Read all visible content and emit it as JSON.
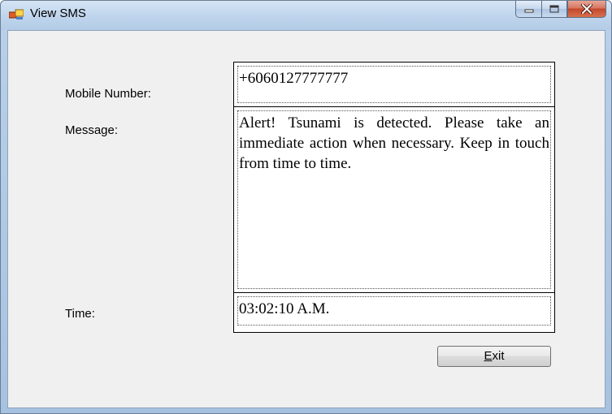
{
  "window": {
    "title": "View SMS",
    "controls": {
      "minimize": "minimize-icon",
      "maximize": "maximize-icon",
      "close": "close-icon"
    }
  },
  "form": {
    "mobile_label": "Mobile Number:",
    "message_label": "Message:",
    "time_label": "Time:",
    "mobile_value": "+6060127777777",
    "message_value": "Alert! Tsunami is detected. Please take an immediate action when necessary. Keep in touch from time to time.",
    "time_value": "03:02:10 A.M."
  },
  "exit_button": {
    "mnemonic": "E",
    "rest": "xit"
  },
  "colors": {
    "titlebar": "#c2d7ee",
    "close_button": "#c4472a",
    "client_background": "#f0f0f0"
  }
}
